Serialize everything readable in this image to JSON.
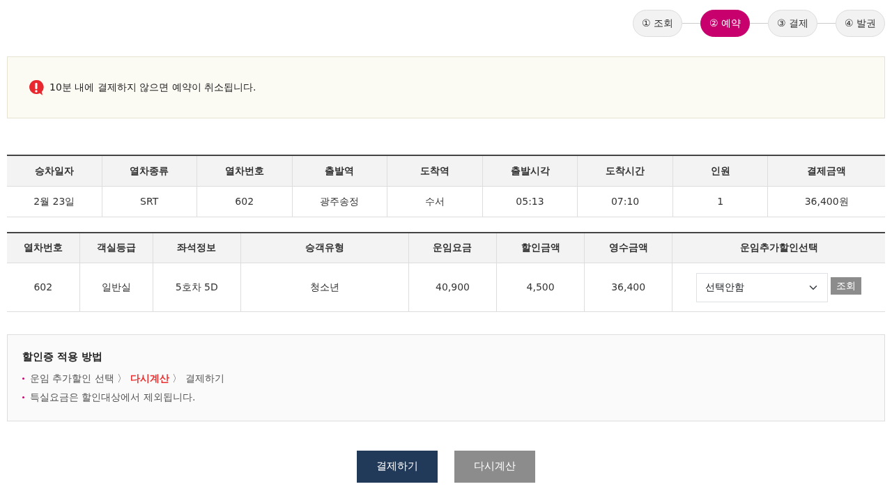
{
  "steps": [
    {
      "label": "① 조회",
      "selected": false
    },
    {
      "label": "② 예약",
      "selected": true
    },
    {
      "label": "③ 결제",
      "selected": false
    },
    {
      "label": "④ 발권",
      "selected": false
    }
  ],
  "notice": {
    "text": "10분 내에 결제하지 않으면 예약이 취소됩니다."
  },
  "train_table": {
    "columns": [
      "승차일자",
      "열차종류",
      "열차번호",
      "출발역",
      "도착역",
      "출발시각",
      "도착시간",
      "인원",
      "결제금액"
    ],
    "rows": [
      [
        "2월 23일",
        "SRT",
        "602",
        "광주송정",
        "수서",
        "05:13",
        "07:10",
        "1",
        "36,400원"
      ]
    ]
  },
  "fare_table": {
    "columns": [
      "열차번호",
      "객실등급",
      "좌석정보",
      "승객유형",
      "운임요금",
      "할인금액",
      "영수금액",
      "운임추가할인선택"
    ],
    "rows": [
      {
        "cells": [
          "602",
          "일반실",
          "5호차 5D",
          "청소년",
          "40,900",
          "4,500",
          "36,400"
        ],
        "discount_select": "선택안함",
        "lookup_button": "조회"
      }
    ]
  },
  "guide": {
    "title": "할인증 적용 방법",
    "items": [
      "운임 추가할인 선택 〉 **다시계산** 〉 결제하기",
      "특실요금은 할인대상에서 제외됩니다."
    ]
  },
  "buttons": [
    {
      "label": "결제하기",
      "kind": "primary"
    },
    {
      "label": "다시계산",
      "kind": "secondary"
    }
  ]
}
